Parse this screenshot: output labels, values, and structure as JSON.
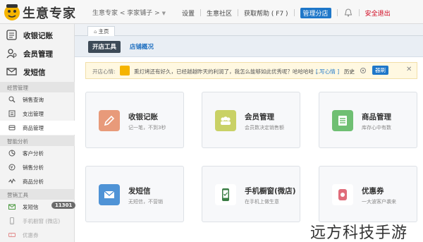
{
  "header": {
    "logo_text": "生意专家",
    "shop_selector": "生意专家 < 李家铺子 >",
    "nav": [
      "设置",
      "生意社区",
      "获取帮助 ( F7 )"
    ],
    "manage_shop": "管理分店",
    "logout": "安全退出"
  },
  "sidebar": {
    "main_items": [
      {
        "label": "收银记账",
        "icon": "cash-register-icon"
      },
      {
        "label": "会员管理",
        "icon": "member-icon"
      },
      {
        "label": "发短信",
        "icon": "envelope-icon"
      }
    ],
    "sections": [
      {
        "title": "经营管理",
        "items": [
          {
            "label": "销售查询",
            "icon": "search-icon"
          },
          {
            "label": "支出管理",
            "icon": "expense-icon"
          },
          {
            "label": "商品管理",
            "icon": "product-icon",
            "active": true
          }
        ]
      },
      {
        "title": "智能分析",
        "items": [
          {
            "label": "客户分析",
            "icon": "customer-analysis-icon"
          },
          {
            "label": "销售分析",
            "icon": "sales-analysis-icon"
          },
          {
            "label": "商品分析",
            "icon": "product-analysis-icon"
          }
        ]
      },
      {
        "title": "营销工具",
        "items": [
          {
            "label": "发短信",
            "icon": "sms-icon",
            "badge": "11301"
          },
          {
            "label": "手机橱窗 (微店)",
            "icon": "mobile-shop-icon",
            "muted": true
          },
          {
            "label": "优惠券",
            "icon": "coupon-icon",
            "muted": true
          }
        ]
      }
    ]
  },
  "content": {
    "page_tab": "主页",
    "subtabs": {
      "active": "开店工具",
      "other": "店铺概况"
    },
    "notice": {
      "label": "开店心情:",
      "message": "熏灯烤还有好久，已经越越昨天的利润了，我怎么能够如此优秀呢？哈哈哈哈 ...",
      "write": "[ 写心情 ]",
      "history": "历史",
      "next": "器刷"
    },
    "cards": [
      {
        "title": "收银记账",
        "desc": "记一笔，不到3秒",
        "color": "#e89a7a",
        "icon": "pencil-icon"
      },
      {
        "title": "会员管理",
        "desc": "会员数决定销售额",
        "color": "#c9d166",
        "icon": "members-icon"
      },
      {
        "title": "商品管理",
        "desc": "库存心中有数",
        "color": "#6fbf73",
        "icon": "list-icon"
      },
      {
        "title": "发短信",
        "desc": "无短信，不营销",
        "color": "#4f93d6",
        "icon": "envelope-icon"
      },
      {
        "title": "手机橱窗(微店)",
        "desc": "在手机上做生意",
        "color": "#ffffff",
        "icon": "phone-icon"
      },
      {
        "title": "优惠券",
        "desc": "一大波客户袭来",
        "color": "#ffffff",
        "icon": "coupon-tag-icon"
      }
    ]
  },
  "watermark": "远方科技手游"
}
